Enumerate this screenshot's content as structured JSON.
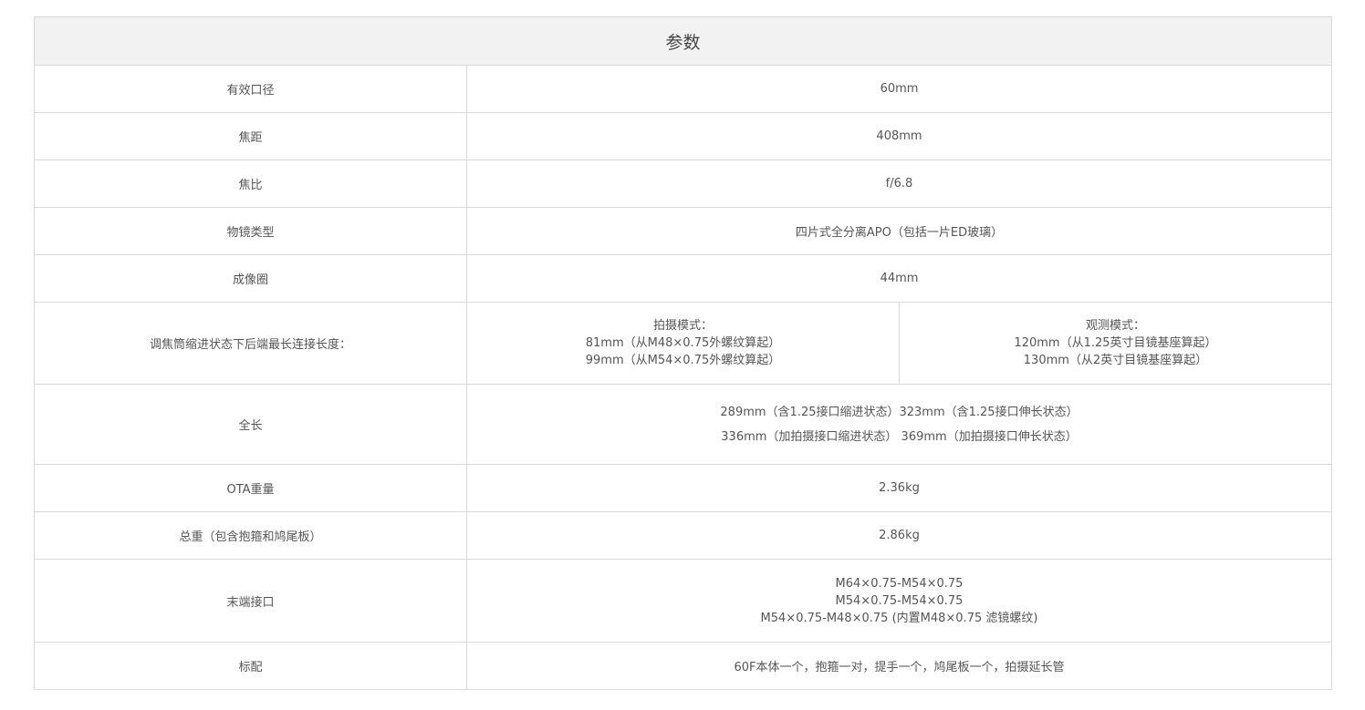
{
  "title": "参数",
  "rows": {
    "aperture": {
      "label": "有效口径",
      "value": "60mm"
    },
    "focal_length": {
      "label": "焦距",
      "value": "408mm"
    },
    "focal_ratio": {
      "label": "焦比",
      "value": "f/6.8"
    },
    "objective_type": {
      "label": "物镜类型",
      "value": "四片式全分离APO（包括一片ED玻璃）"
    },
    "image_circle": {
      "label": "成像圈",
      "value": "44mm"
    },
    "back_length": {
      "label": "调焦筒缩进状态下后端最长连接长度：",
      "photo": [
        "拍摄模式：",
        "81mm（从M48×0.75外螺纹算起）",
        "99mm（从M54×0.75外螺纹算起）"
      ],
      "visual": [
        "观测模式：",
        "120mm（从1.25英寸目镜基座算起）",
        "130mm（从2英寸目镜基座算起）"
      ]
    },
    "length": {
      "label": "全长",
      "lines": [
        "289mm（含1.25接口缩进状态）323mm（含1.25接口伸长状态）",
        "336mm（加拍摄接口缩进状态） 369mm（加拍摄接口伸长状态）"
      ]
    },
    "ota_weight": {
      "label": "OTA重量",
      "value": "2.36kg"
    },
    "total_weight": {
      "label": "总重（包含抱箍和鸠尾板）",
      "value": "2.86kg"
    },
    "rear_interface": {
      "label": "末端接口",
      "lines": [
        "M64×0.75-M54×0.75",
        "M54×0.75-M54×0.75",
        "M54×0.75-M48×0.75 (内置M48×0.75 滤镜螺纹)"
      ]
    },
    "standard": {
      "label": "标配",
      "value": "60F本体一个，抱箍一对，提手一个，鸠尾板一个，拍摄延长管"
    }
  }
}
